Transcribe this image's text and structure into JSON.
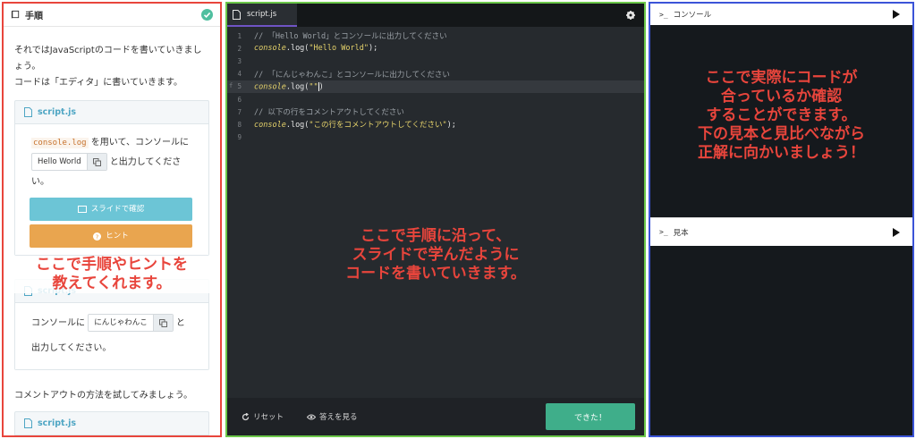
{
  "steps_panel": {
    "title": "手順",
    "intro_line1": "それではJavaScriptのコードを書いていきましょう。",
    "intro_line2": "コードは「エディタ」に書いていきます。",
    "card1": {
      "filename": "script.js",
      "code_term": "console.log",
      "text_a": "を用いて、コンソールに",
      "chip": "Hello World",
      "text_b": "と出力してください。",
      "slide_button": "スライドで確認",
      "hint_button": "ヒント"
    },
    "card2": {
      "filename": "script.js",
      "text_a": "コンソールに",
      "chip": "にんじゃわんこ",
      "text_b": "と",
      "text_c": "出力してください。"
    },
    "comment_intro": "コメントアウトの方法を試してみましょう。",
    "card3_filename": "script.js",
    "overlay": [
      "ここで手順やヒントを",
      "教えてくれます。"
    ]
  },
  "editor": {
    "tab": "script.js",
    "lines": [
      {
        "num": "1",
        "comment": "// 「Hello World」とコンソールに出力してください"
      },
      {
        "num": "2",
        "obj": "console",
        "method": ".log(",
        "str": "\"Hello World\"",
        "tail": ");"
      },
      {
        "num": "3"
      },
      {
        "num": "4",
        "comment": "// 「にんじゃわんこ」とコンソールに出力してください"
      },
      {
        "num": "5",
        "obj": "console",
        "method": ".log(",
        "str": "\"\"",
        "tail": ")"
      },
      {
        "num": "6"
      },
      {
        "num": "7",
        "comment": "// 以下の行をコメントアウトしてください"
      },
      {
        "num": "8",
        "obj": "console",
        "method": ".log(",
        "str": "\"この行をコメントアウトしてください\"",
        "tail": ");"
      },
      {
        "num": "9"
      }
    ],
    "fn_marker": "f",
    "overlay": [
      "ここで手順に沿って、",
      "スライドで学んだように",
      "コードを書いていきます。"
    ],
    "reset_label": "リセット",
    "answer_label": "答えを見る",
    "done_label": "できた！"
  },
  "console_panel": {
    "console_title": "コンソール",
    "sample_title": "見本",
    "prompt_symbol": ">_",
    "overlay": [
      "ここで実際にコードが",
      "合っているか確認",
      "することができます。",
      "下の見本と見比べながら",
      "正解に向かいましょう！"
    ]
  },
  "colors": {
    "left_border": "#e8453c",
    "mid_border": "#6cc84a",
    "right_border": "#3b54d8",
    "overlay_text": "#e8453c",
    "done_button": "#3fae8a"
  }
}
